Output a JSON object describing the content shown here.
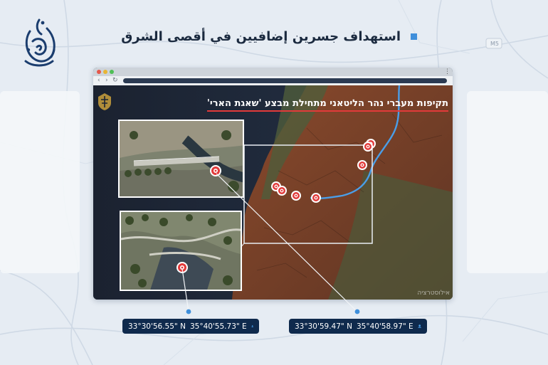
{
  "headline": {
    "text": "استهداف جسرين إضافيين في أقصى الشرق"
  },
  "map_label": {
    "road_sign": "M5"
  },
  "browser": {
    "nav_back": "‹",
    "nav_forward": "›",
    "nav_reload": "↻",
    "menu": "⋮",
    "video_title": "תקיפות מעברי נהר הליטאני מתחילת מבצע 'שאגת הארי'",
    "watermark": "אילוסטרציה"
  },
  "coordinates": {
    "left": {
      "lat": "33°30'56.55\" N",
      "lon": "35°40'55.73\" E"
    },
    "right": {
      "lat": "33°30'59.47\" N",
      "lon": "35°40'58.97\" E"
    }
  },
  "colors": {
    "accent": "#3f8fdb",
    "badge_bg": "#0f2a4d",
    "target_red": "#e23a3a",
    "river_blue": "#4a9ee8"
  },
  "icons": {
    "logo": "al-jazeera-logo",
    "bullet": "square-bullet-icon",
    "pin": "location-pin-icon",
    "emblem": "idf-emblem-icon"
  }
}
